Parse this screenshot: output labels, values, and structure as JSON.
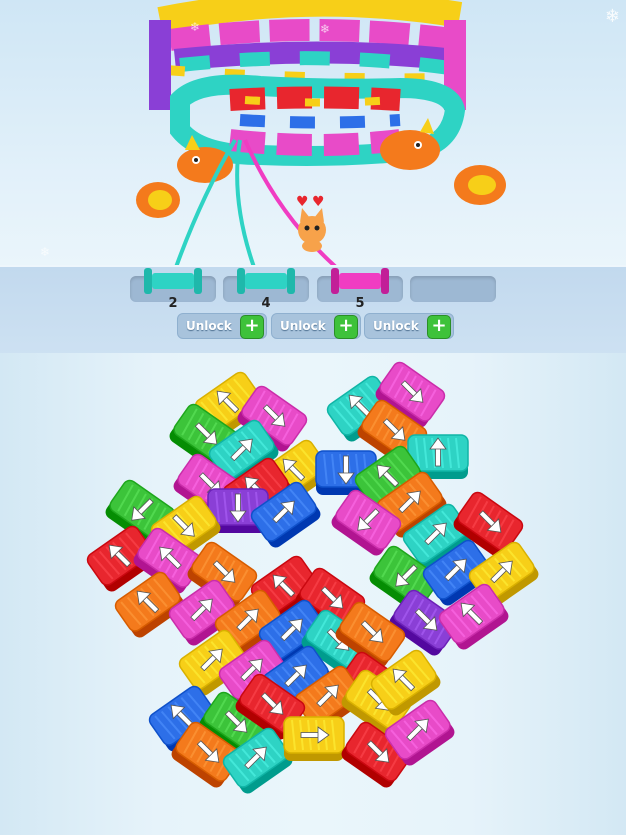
{
  "colors": {
    "red": "#e8262e",
    "orange": "#f47a1c",
    "yellow": "#f7cf18",
    "green": "#3cc43a",
    "cyan": "#2ed3c4",
    "blue": "#2d6fe8",
    "purple": "#8a3fd6",
    "pink": "#e84bc8",
    "magenta": "#f03cc2"
  },
  "tray": {
    "spools": [
      {
        "color": "cyan",
        "count": "2"
      },
      {
        "color": "cyan",
        "count": "4"
      },
      {
        "color": "magenta",
        "count": "5"
      }
    ],
    "unlock_buttons": [
      {
        "label": "Unlock",
        "icon": "plus-icon"
      },
      {
        "label": "Unlock",
        "icon": "plus-icon"
      },
      {
        "label": "Unlock",
        "icon": "plus-icon"
      }
    ]
  },
  "scene": {
    "icons": [
      "snowflake-icon",
      "heart-icon",
      "heart-icon",
      "cat-icon",
      "dragon-icon",
      "dragon-icon",
      "fire-icon"
    ],
    "settings_icon": "snowflake-gear-icon"
  },
  "blocks": [
    {
      "color": "yellow",
      "arrow": "up-left"
    },
    {
      "color": "pink",
      "arrow": "down-right"
    },
    {
      "color": "green",
      "arrow": "down-right"
    },
    {
      "color": "cyan",
      "arrow": "up-right"
    },
    {
      "color": "yellow",
      "arrow": "up-left"
    },
    {
      "color": "pink",
      "arrow": "down-right"
    },
    {
      "color": "red",
      "arrow": "up-left"
    },
    {
      "color": "purple",
      "arrow": "down"
    },
    {
      "color": "blue",
      "arrow": "up-right"
    },
    {
      "color": "cyan",
      "arrow": "up-left"
    },
    {
      "color": "pink",
      "arrow": "down-right"
    },
    {
      "color": "orange",
      "arrow": "down-right"
    },
    {
      "color": "cyan",
      "arrow": "up"
    },
    {
      "color": "blue",
      "arrow": "down"
    },
    {
      "color": "green",
      "arrow": "up-left"
    },
    {
      "color": "orange",
      "arrow": "up-right"
    },
    {
      "color": "pink",
      "arrow": "down-left"
    },
    {
      "color": "green",
      "arrow": "down-left"
    },
    {
      "color": "yellow",
      "arrow": "down-right"
    },
    {
      "color": "red",
      "arrow": "up-left"
    },
    {
      "color": "pink",
      "arrow": "up-left"
    },
    {
      "color": "orange",
      "arrow": "down-right"
    },
    {
      "color": "orange",
      "arrow": "up-left"
    },
    {
      "color": "pink",
      "arrow": "up-right"
    },
    {
      "color": "cyan",
      "arrow": "up-right"
    },
    {
      "color": "red",
      "arrow": "down-right"
    },
    {
      "color": "green",
      "arrow": "down-left"
    },
    {
      "color": "blue",
      "arrow": "up-right"
    },
    {
      "color": "yellow",
      "arrow": "up-right"
    },
    {
      "color": "purple",
      "arrow": "down-right"
    },
    {
      "color": "pink",
      "arrow": "up-left"
    },
    {
      "color": "red",
      "arrow": "up-left"
    },
    {
      "color": "red",
      "arrow": "down-right"
    },
    {
      "color": "orange",
      "arrow": "up-right"
    },
    {
      "color": "blue",
      "arrow": "up-right"
    },
    {
      "color": "cyan",
      "arrow": "down-right"
    },
    {
      "color": "orange",
      "arrow": "down-right"
    },
    {
      "color": "yellow",
      "arrow": "up-right"
    },
    {
      "color": "pink",
      "arrow": "up-right"
    },
    {
      "color": "blue",
      "arrow": "up-right"
    },
    {
      "color": "red",
      "arrow": "down-right"
    },
    {
      "color": "orange",
      "arrow": "up-right"
    },
    {
      "color": "yellow",
      "arrow": "down-right"
    },
    {
      "color": "yellow",
      "arrow": "up-left"
    },
    {
      "color": "blue",
      "arrow": "up-left"
    },
    {
      "color": "green",
      "arrow": "down-right"
    },
    {
      "color": "red",
      "arrow": "down-right"
    },
    {
      "color": "orange",
      "arrow": "down-right"
    },
    {
      "color": "cyan",
      "arrow": "up-right"
    },
    {
      "color": "yellow",
      "arrow": "right"
    },
    {
      "color": "red",
      "arrow": "down-right"
    },
    {
      "color": "pink",
      "arrow": "up-right"
    }
  ]
}
